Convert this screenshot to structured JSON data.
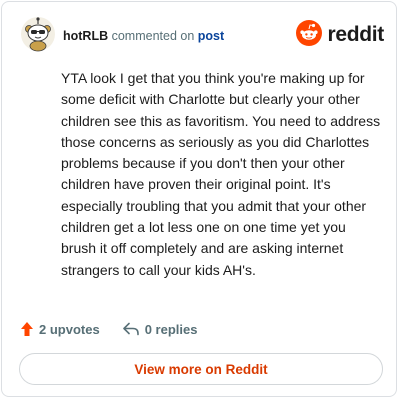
{
  "header": {
    "username": "hotRLB",
    "commented_on": "commented on",
    "post_link": "post",
    "logo_text": "reddit"
  },
  "comment": {
    "body": "YTA look I get that you think you're making up for some deficit with Charlotte but clearly your other children see this as favoritism. You need to address those concerns as seriously as you did Charlottes problems because if you don't then your other children have proven their original point. It's especially troubling that you admit that your other children get a lot less one on one time yet you brush it off completely and are asking internet strangers to call your kids AH's."
  },
  "actions": {
    "upvotes": "2 upvotes",
    "replies": "0 replies"
  },
  "footer": {
    "view_button": "View more on Reddit"
  },
  "colors": {
    "brand": "#ff4500",
    "button_text": "#d93a00",
    "link": "#0a449b"
  },
  "icons": [
    "avatar-snoo-icon",
    "reddit-logo-icon",
    "upvote-arrow-icon",
    "reply-arrow-icon"
  ]
}
